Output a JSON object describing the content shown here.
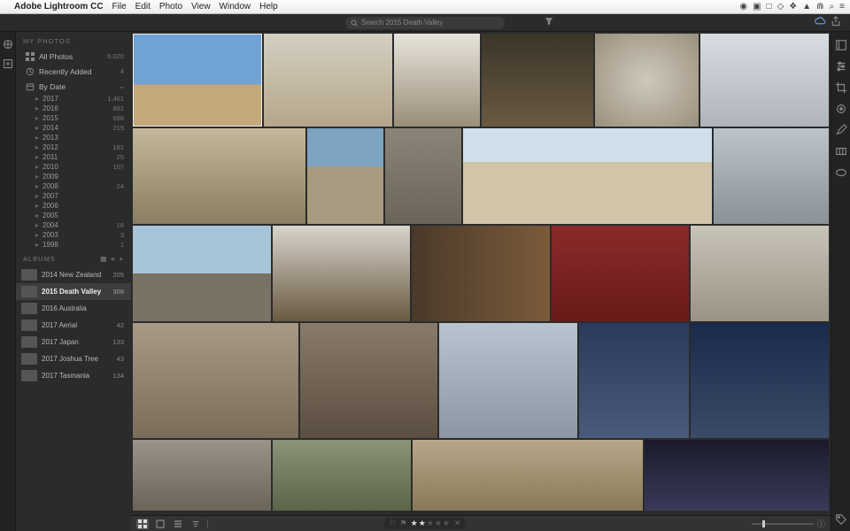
{
  "menubar": {
    "app": "Adobe Lightroom CC",
    "items": [
      "File",
      "Edit",
      "Photo",
      "View",
      "Window",
      "Help"
    ]
  },
  "search": {
    "placeholder": "Search 2015 Death Valley"
  },
  "sidebar": {
    "my_photos_hdr": "MY PHOTOS",
    "all_photos": {
      "label": "All Photos",
      "count": "6,020"
    },
    "recently_added": {
      "label": "Recently Added",
      "count": "4"
    },
    "by_date": {
      "label": "By Date"
    },
    "years": [
      {
        "label": "2017",
        "count": "1,461"
      },
      {
        "label": "2016",
        "count": "891"
      },
      {
        "label": "2015",
        "count": "698"
      },
      {
        "label": "2014",
        "count": "215"
      },
      {
        "label": "2013",
        "count": ""
      },
      {
        "label": "2012",
        "count": "181"
      },
      {
        "label": "2011",
        "count": "25"
      },
      {
        "label": "2010",
        "count": "107"
      },
      {
        "label": "2009",
        "count": ""
      },
      {
        "label": "2008",
        "count": "24"
      },
      {
        "label": "2007",
        "count": ""
      },
      {
        "label": "2006",
        "count": ""
      },
      {
        "label": "2005",
        "count": ""
      },
      {
        "label": "2004",
        "count": "18"
      },
      {
        "label": "2003",
        "count": "3"
      },
      {
        "label": "1998",
        "count": "1"
      }
    ],
    "albums_hdr": "ALBUMS",
    "albums": [
      {
        "label": "2014 New Zealand",
        "count": "205",
        "thumb": "th1"
      },
      {
        "label": "2015 Death Valley",
        "count": "300",
        "thumb": "th2",
        "selected": true
      },
      {
        "label": "2016 Australia",
        "count": "",
        "thumb": "th3"
      },
      {
        "label": "2017 Aerial",
        "count": "42",
        "thumb": "th4"
      },
      {
        "label": "2017 Japan",
        "count": "133",
        "thumb": "th5"
      },
      {
        "label": "2017 Joshua Tree",
        "count": "43",
        "thumb": "th6"
      },
      {
        "label": "2017 Tasmania",
        "count": "134",
        "thumb": "th7"
      }
    ]
  },
  "bottombar": {
    "rating": "★★★★★",
    "rating_filled": 2
  }
}
